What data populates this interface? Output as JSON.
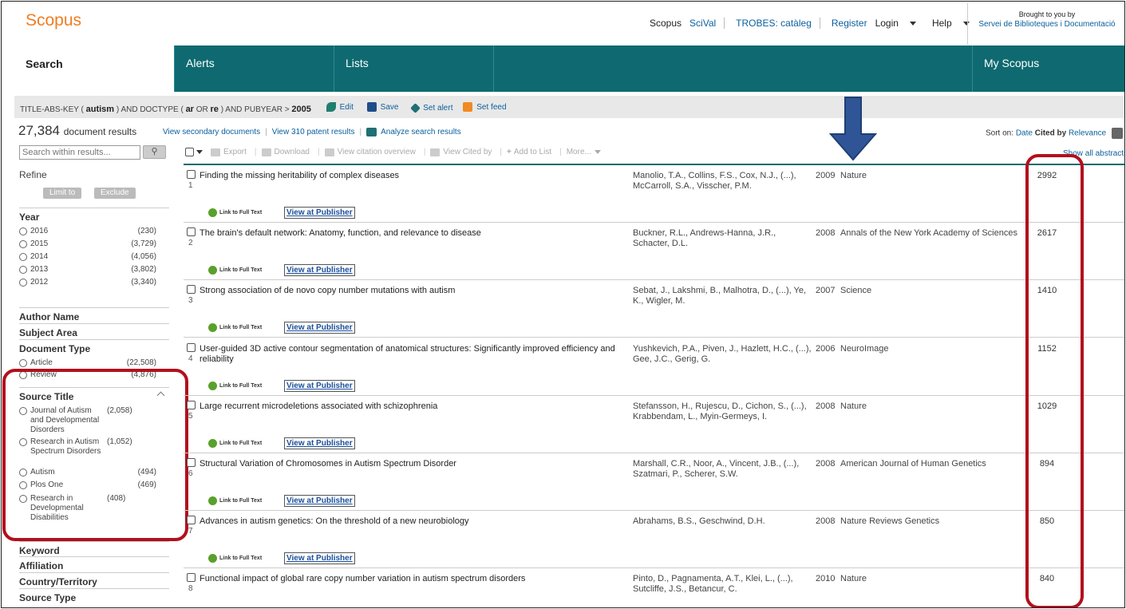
{
  "header": {
    "logo": "Scopus",
    "nav": [
      "Scopus",
      "SciVal",
      "TROBES: catàleg",
      "Register",
      "Login",
      "Help"
    ],
    "brought_by": "Brought to you by",
    "institution": "Servei de Biblioteques i Documentació"
  },
  "tabs": [
    "Search",
    "Alerts",
    "Lists",
    "My Scopus"
  ],
  "query": {
    "p1": "TITLE-ABS-KEY",
    "term1": "autism",
    "p2": "AND  DOCTYPE",
    "term2": "ar",
    "p3": "OR",
    "term3": "re",
    "p4": "AND  PUBYEAR  >",
    "term4": "2005",
    "edit": "Edit",
    "save": "Save",
    "set_alert": "Set alert",
    "set_feed": "Set feed"
  },
  "results": {
    "count": "27,384",
    "label": "document results",
    "secondary": "View secondary documents",
    "patents": "View 310 patent results",
    "analyze": "Analyze search results",
    "sort_on": "Sort on:",
    "sort_date": "Date",
    "sort_cited": "Cited by",
    "sort_relevance": "Relevance",
    "show_all": "Show all abstracts"
  },
  "sidebar": {
    "search_placeholder": "Search within results...",
    "refine": "Refine",
    "limit_to": "Limit to",
    "exclude": "Exclude",
    "year_title": "Year",
    "years": [
      {
        "label": "2016",
        "count": "(230)"
      },
      {
        "label": "2015",
        "count": "(3,729)"
      },
      {
        "label": "2014",
        "count": "(4,056)"
      },
      {
        "label": "2013",
        "count": "(3,802)"
      },
      {
        "label": "2012",
        "count": "(3,340)"
      }
    ],
    "author_name": "Author Name",
    "subject_area": "Subject Area",
    "document_type": "Document Type",
    "doc_types": [
      {
        "label": "Article",
        "count": "(22,508)"
      },
      {
        "label": "Review",
        "count": "(4,876)"
      }
    ],
    "source_title": "Source Title",
    "sources": [
      {
        "label": "Journal of Autism and Developmental Disorders",
        "count": "(2,058)"
      },
      {
        "label": "Research in Autism Spectrum Disorders",
        "count": "(1,052)"
      },
      {
        "label": "Autism",
        "count": "(494)"
      },
      {
        "label": "Plos One",
        "count": "(469)"
      },
      {
        "label": "Research in Developmental Disabilities",
        "count": "(408)"
      }
    ],
    "keyword": "Keyword",
    "affiliation": "Affiliation",
    "country": "Country/Territory",
    "source_type": "Source Type"
  },
  "toolbar": {
    "export": "Export",
    "download": "Download",
    "citation_overview": "View citation overview",
    "view_cited_by": "View Cited by",
    "add_to_list": "Add to List",
    "more": "More..."
  },
  "row_links": {
    "full_text": "Link to Full Text",
    "publisher": "View at Publisher"
  },
  "documents": [
    {
      "num": "1",
      "title": "Finding the missing heritability of complex diseases",
      "authors": "Manolio, T.A., Collins, F.S., Cox, N.J., (...), McCarroll, S.A., Visscher, P.M.",
      "year": "2009",
      "source": "Nature",
      "cited": "2992"
    },
    {
      "num": "2",
      "title": "The brain's default network: Anatomy, function, and relevance to disease",
      "authors": "Buckner, R.L., Andrews-Hanna, J.R., Schacter, D.L.",
      "year": "2008",
      "source": "Annals of the New York Academy of Sciences",
      "cited": "2617"
    },
    {
      "num": "3",
      "title": "Strong association of de novo copy number mutations with autism",
      "authors": "Sebat, J., Lakshmi, B., Malhotra, D., (...), Ye, K., Wigler, M.",
      "year": "2007",
      "source": "Science",
      "cited": "1410"
    },
    {
      "num": "4",
      "title": "User-guided 3D active contour segmentation of anatomical structures: Significantly improved efficiency and reliability",
      "authors": "Yushkevich, P.A., Piven, J., Hazlett, H.C., (...), Gee, J.C., Gerig, G.",
      "year": "2006",
      "source": "NeuroImage",
      "cited": "1152"
    },
    {
      "num": "5",
      "title": "Large recurrent microdeletions associated with schizophrenia",
      "authors": "Stefansson, H., Rujescu, D., Cichon, S., (...), Krabbendam, L., Myin-Germeys, I.",
      "year": "2008",
      "source": "Nature",
      "cited": "1029"
    },
    {
      "num": "6",
      "title": "Structural Variation of Chromosomes in Autism Spectrum Disorder",
      "authors": "Marshall, C.R., Noor, A., Vincent, J.B., (...), Szatmari, P., Scherer, S.W.",
      "year": "2008",
      "source": "American Journal of Human Genetics",
      "cited": "894"
    },
    {
      "num": "7",
      "title": "Advances in autism genetics: On the threshold of a new neurobiology",
      "authors": "Abrahams, B.S., Geschwind, D.H.",
      "year": "2008",
      "source": "Nature Reviews Genetics",
      "cited": "850"
    },
    {
      "num": "8",
      "title": "Functional impact of global rare copy number variation in autism spectrum disorders",
      "authors": "Pinto, D., Pagnamenta, A.T., Klei, L., (...), Sutcliffe, J.S., Betancur, C.",
      "year": "2010",
      "source": "Nature",
      "cited": "840"
    }
  ],
  "colors": {
    "brand_orange": "#f07d22",
    "nav_teal": "#0e6a70",
    "highlight_red": "#b30f1d",
    "arrow_blue": "#2f5597"
  }
}
